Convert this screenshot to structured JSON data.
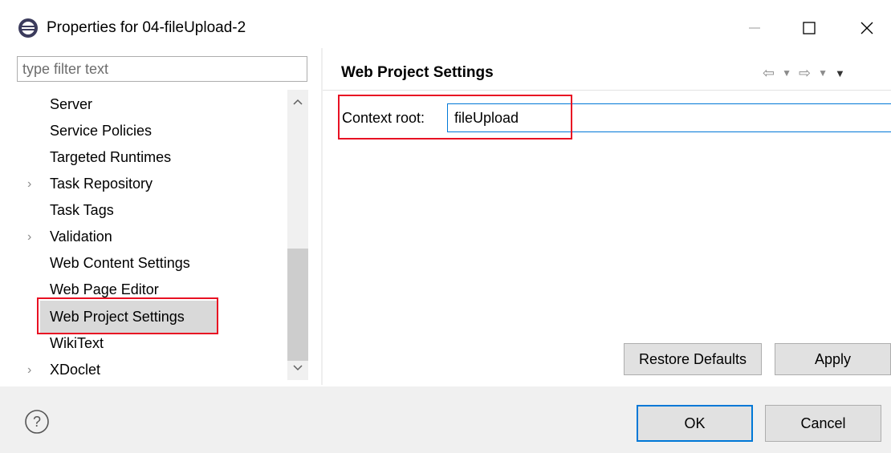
{
  "window": {
    "title": "Properties for 04-fileUpload-2",
    "minimize_icon": "minimize-icon",
    "maximize_icon": "maximize-icon",
    "close_icon": "close-icon"
  },
  "filter": {
    "placeholder": "type filter text",
    "value": ""
  },
  "tree": {
    "items": [
      {
        "label": "Server",
        "expandable": false
      },
      {
        "label": "Service Policies",
        "expandable": false
      },
      {
        "label": "Targeted Runtimes",
        "expandable": false
      },
      {
        "label": "Task Repository",
        "expandable": true
      },
      {
        "label": "Task Tags",
        "expandable": false
      },
      {
        "label": "Validation",
        "expandable": true
      },
      {
        "label": "Web Content Settings",
        "expandable": false
      },
      {
        "label": "Web Page Editor",
        "expandable": false
      },
      {
        "label": "Web Project Settings",
        "expandable": false,
        "selected": true
      },
      {
        "label": "WikiText",
        "expandable": false
      },
      {
        "label": "XDoclet",
        "expandable": true
      }
    ]
  },
  "page": {
    "title": "Web Project Settings",
    "context_root_label": "Context root:",
    "context_root_value": "fileUpload"
  },
  "buttons": {
    "restore_defaults": "Restore Defaults",
    "apply": "Apply",
    "ok": "OK",
    "cancel": "Cancel"
  },
  "colors": {
    "highlight": "#e81123",
    "focus": "#0078d7",
    "selection": "#d9d9d9"
  }
}
